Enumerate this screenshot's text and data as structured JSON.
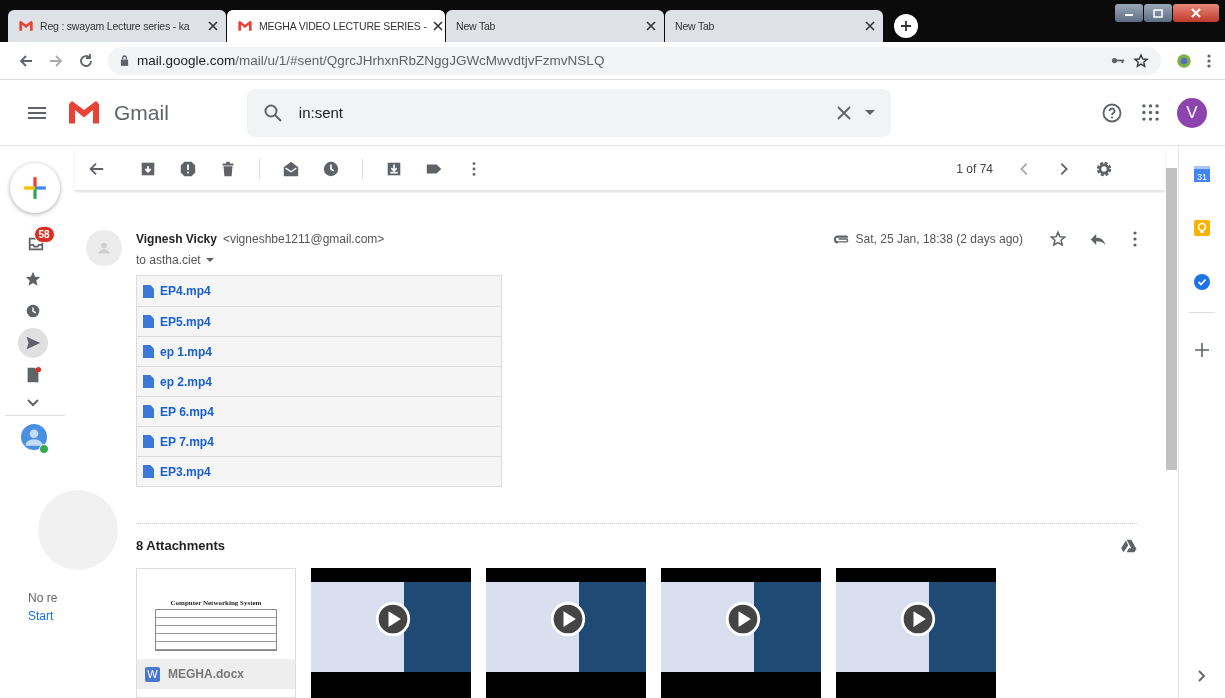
{
  "browser": {
    "tabs": [
      {
        "title": "Reg : swayam Lecture series - ka",
        "kind": "gmail",
        "selected": false
      },
      {
        "title": "MEGHA VIDEO LECTURE SERIES -",
        "kind": "gmail",
        "selected": true
      },
      {
        "title": "New Tab",
        "kind": "blank",
        "selected": false
      },
      {
        "title": "New Tab",
        "kind": "blank",
        "selected": false
      }
    ],
    "url_host": "mail.google.com",
    "url_path": "/mail/u/1/#sent/QgrcJHrhxnRbZNggJGWcMwvdtjvFzmvNSLQ"
  },
  "header": {
    "logo_text": "Gmail",
    "search_value": "in:sent",
    "avatar_letter": "V"
  },
  "rail": {
    "items": [
      {
        "kind": "inbox",
        "badge": "58",
        "selected": false
      },
      {
        "kind": "starred",
        "selected": false
      },
      {
        "kind": "snoozed",
        "selected": false
      },
      {
        "kind": "sent",
        "selected": true
      },
      {
        "kind": "drafts",
        "selected": false
      }
    ],
    "hangouts_text": "No re",
    "hangouts_link": "Start"
  },
  "toolbar": {
    "pager": "1 of 74"
  },
  "message": {
    "sender_name": "Vignesh Vicky",
    "sender_email": "<vigneshbe1211@gmail.com>",
    "recipient": "to astha.ciet",
    "date": "Sat, 25 Jan, 18:38 (2 days ago)",
    "starred": false,
    "links": [
      "EP4.mp4",
      "EP5.mp4",
      "ep 1.mp4",
      "ep 2.mp4",
      "EP 6.mp4",
      "EP 7.mp4",
      "EP3.mp4"
    ]
  },
  "attachments": {
    "heading": "8 Attachments",
    "items": [
      {
        "kind": "doc",
        "name": "MEGHA.docx",
        "type_letter": "W",
        "preview_title": "Computer Networking System"
      },
      {
        "kind": "video"
      },
      {
        "kind": "video"
      },
      {
        "kind": "video"
      },
      {
        "kind": "video"
      }
    ]
  },
  "side_panel": {
    "calendar_day": "31"
  }
}
